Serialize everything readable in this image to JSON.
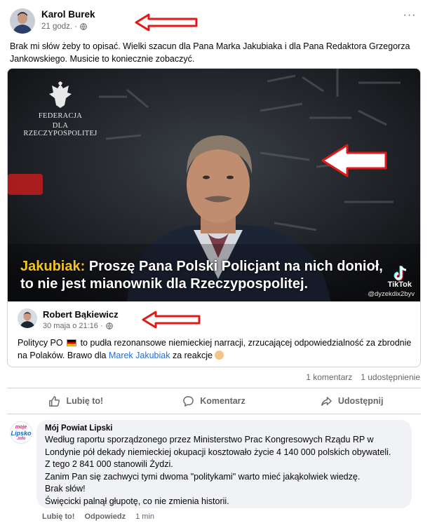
{
  "post": {
    "author": "Karol Burek",
    "time": "21 godz. ·",
    "text": "Brak mi słów żeby to opisać. Wielki szacun dla Pana Marka Jakubiaka i dla Pana Redaktora Grzegorza Jankowskiego. Musicie to koniecznie zobaczyć."
  },
  "video": {
    "emblem_line1": "FEDERACJA",
    "emblem_line2": "DLA RZECZYPOSPOLITEJ",
    "subtitle_speaker": "Jakubiak:",
    "subtitle_line1": " Proszę Pana Polski Policjant na nich donioł,",
    "subtitle_line2": "to nie jest mianownik dla Rzeczypospolitej.",
    "tiktok_label": "TikTok",
    "tiktok_handle": "@dyzekdix2byv"
  },
  "shared": {
    "author": "Robert Bąkiewicz",
    "time": "30 maja o 21:16 ·",
    "text_before_flag": "Politycy PO",
    "text_after_flag": " to pudła rezonansowe niemieckiej narracji, zrzucającej odpowiedzialność za zbrodnie na Polaków. Brawo dla ",
    "mention": "Marek Jakubiak",
    "text_end": " za reakcje "
  },
  "stats": {
    "comments": "1 komentarz",
    "shares": "1 udostępnienie"
  },
  "actions": {
    "like": "Lubię to!",
    "comment": "Komentarz",
    "share": "Udostępnij"
  },
  "comment": {
    "logo_line1": "moje",
    "logo_line2": "Lipsko",
    "logo_line3": ".info",
    "author": "Mój Powiat Lipski",
    "lines": [
      "Według raportu sporządzonego przez Ministerstwo Prac Kongresowych Rządu RP w",
      "Londynie pół dekady niemieckiej okupacji kosztowało życie 4 140 000 polskich obywateli.",
      "Z tego 2 841 000 stanowili Żydzi.",
      "Zanim Pan się zachwyci tymi dwoma \"politykami\" warto mieć jakąkolwiek wiedzę.",
      "Brak słów!",
      "Święcicki palnął głupotę, co nie zmienia historii."
    ],
    "like": "Lubię to!",
    "reply": "Odpowiedz",
    "time": "1 min"
  },
  "colors": {
    "link": "#216fdb",
    "arrow": "#e01a1a",
    "subtitle_speaker": "#f5c518"
  }
}
